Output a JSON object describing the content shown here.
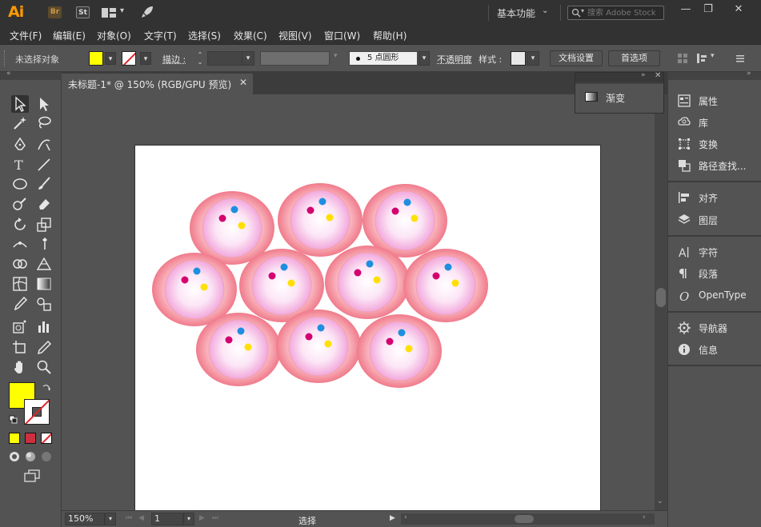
{
  "app": {
    "logo": "Ai",
    "bridge_label": "Br",
    "stock_label": "St",
    "workspace": "基本功能",
    "search_placeholder": "搜索 Adobe Stock"
  },
  "menus": [
    "文件(F)",
    "编辑(E)",
    "对象(O)",
    "文字(T)",
    "选择(S)",
    "效果(C)",
    "视图(V)",
    "窗口(W)",
    "帮助(H)"
  ],
  "control": {
    "selection_status": "未选择对象",
    "stroke_label": "描边 :",
    "brush_label": "5 点圆形",
    "opacity_label": "不透明度",
    "style_label": "样式 :",
    "doc_setup_button": "文档设置",
    "prefs_button": "首选项",
    "fill_color": "#ffff00"
  },
  "document": {
    "tab_title": "未标题-1* @ 150% (RGB/GPU 预览)"
  },
  "gradient_panel": {
    "label": "渐变"
  },
  "right_panels": [
    {
      "label": "属性",
      "icon": "properties-icon"
    },
    {
      "label": "库",
      "icon": "libraries-icon"
    },
    {
      "label": "变换",
      "icon": "transform-icon"
    },
    {
      "label": "路径查找...",
      "icon": "pathfinder-icon"
    },
    {
      "label": "对齐",
      "icon": "align-icon"
    },
    {
      "label": "图层",
      "icon": "layers-icon"
    },
    {
      "label": "字符",
      "icon": "character-icon"
    },
    {
      "label": "段落",
      "icon": "paragraph-icon"
    },
    {
      "label": "OpenType",
      "icon": "opentype-icon"
    },
    {
      "label": "导航器",
      "icon": "navigator-icon"
    },
    {
      "label": "信息",
      "icon": "info-icon"
    }
  ],
  "status": {
    "zoom": "150%",
    "page": "1",
    "tool": "选择"
  },
  "artwork": {
    "outer_color": "#f07a8a",
    "inner_color": "#fce6f6",
    "dot_colors": {
      "blue": "#1e8fe0",
      "magenta": "#d4006f",
      "yellow": "#ffe000"
    }
  }
}
